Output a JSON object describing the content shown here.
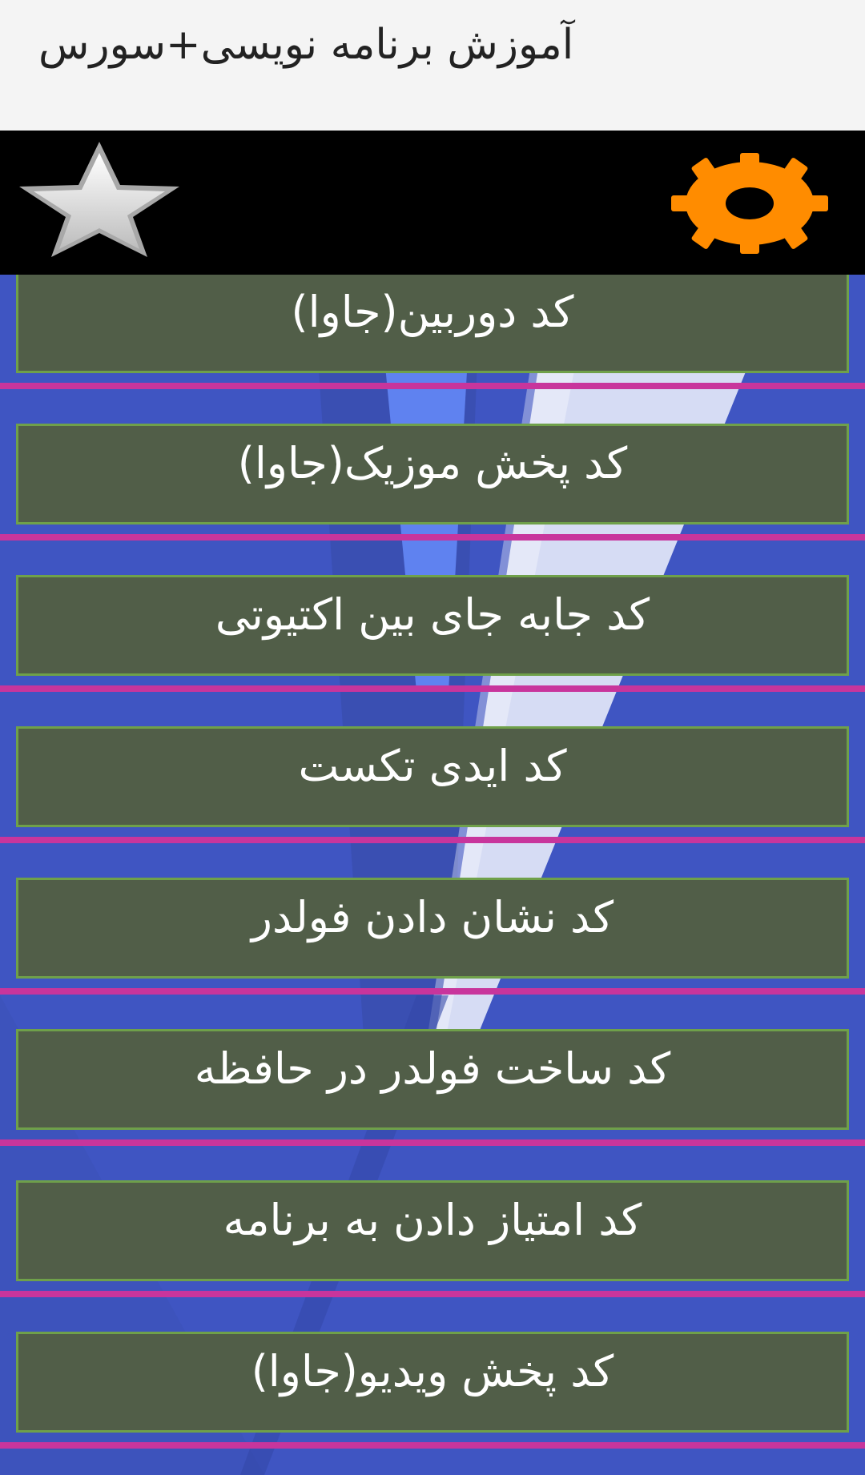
{
  "app": {
    "title": "آموزش برنامه نویسی+سورس"
  },
  "toolbar": {
    "left_icon": "star-icon",
    "right_icon": "gear-icon",
    "accent_star": "#d9d9d9",
    "accent_gear": "#ff8c00"
  },
  "list": {
    "items": [
      {
        "label": "کد دوربین(جاوا)"
      },
      {
        "label": "کد پخش موزیک(جاوا)"
      },
      {
        "label": "کد جابه جای بین اکتیوتی"
      },
      {
        "label": "کد ایدی تکست"
      },
      {
        "label": "کد نشان دادن فولدر"
      },
      {
        "label": "کد ساخت فولدر در حافظه"
      },
      {
        "label": "کد امتیاز دادن به برنامه"
      },
      {
        "label": "کد پخش ویدیو(جاوا)"
      }
    ]
  },
  "colors": {
    "background": "#4157c4",
    "item_fill": "#515e48",
    "item_border": "#6fa04a",
    "divider": "#c8359c"
  }
}
